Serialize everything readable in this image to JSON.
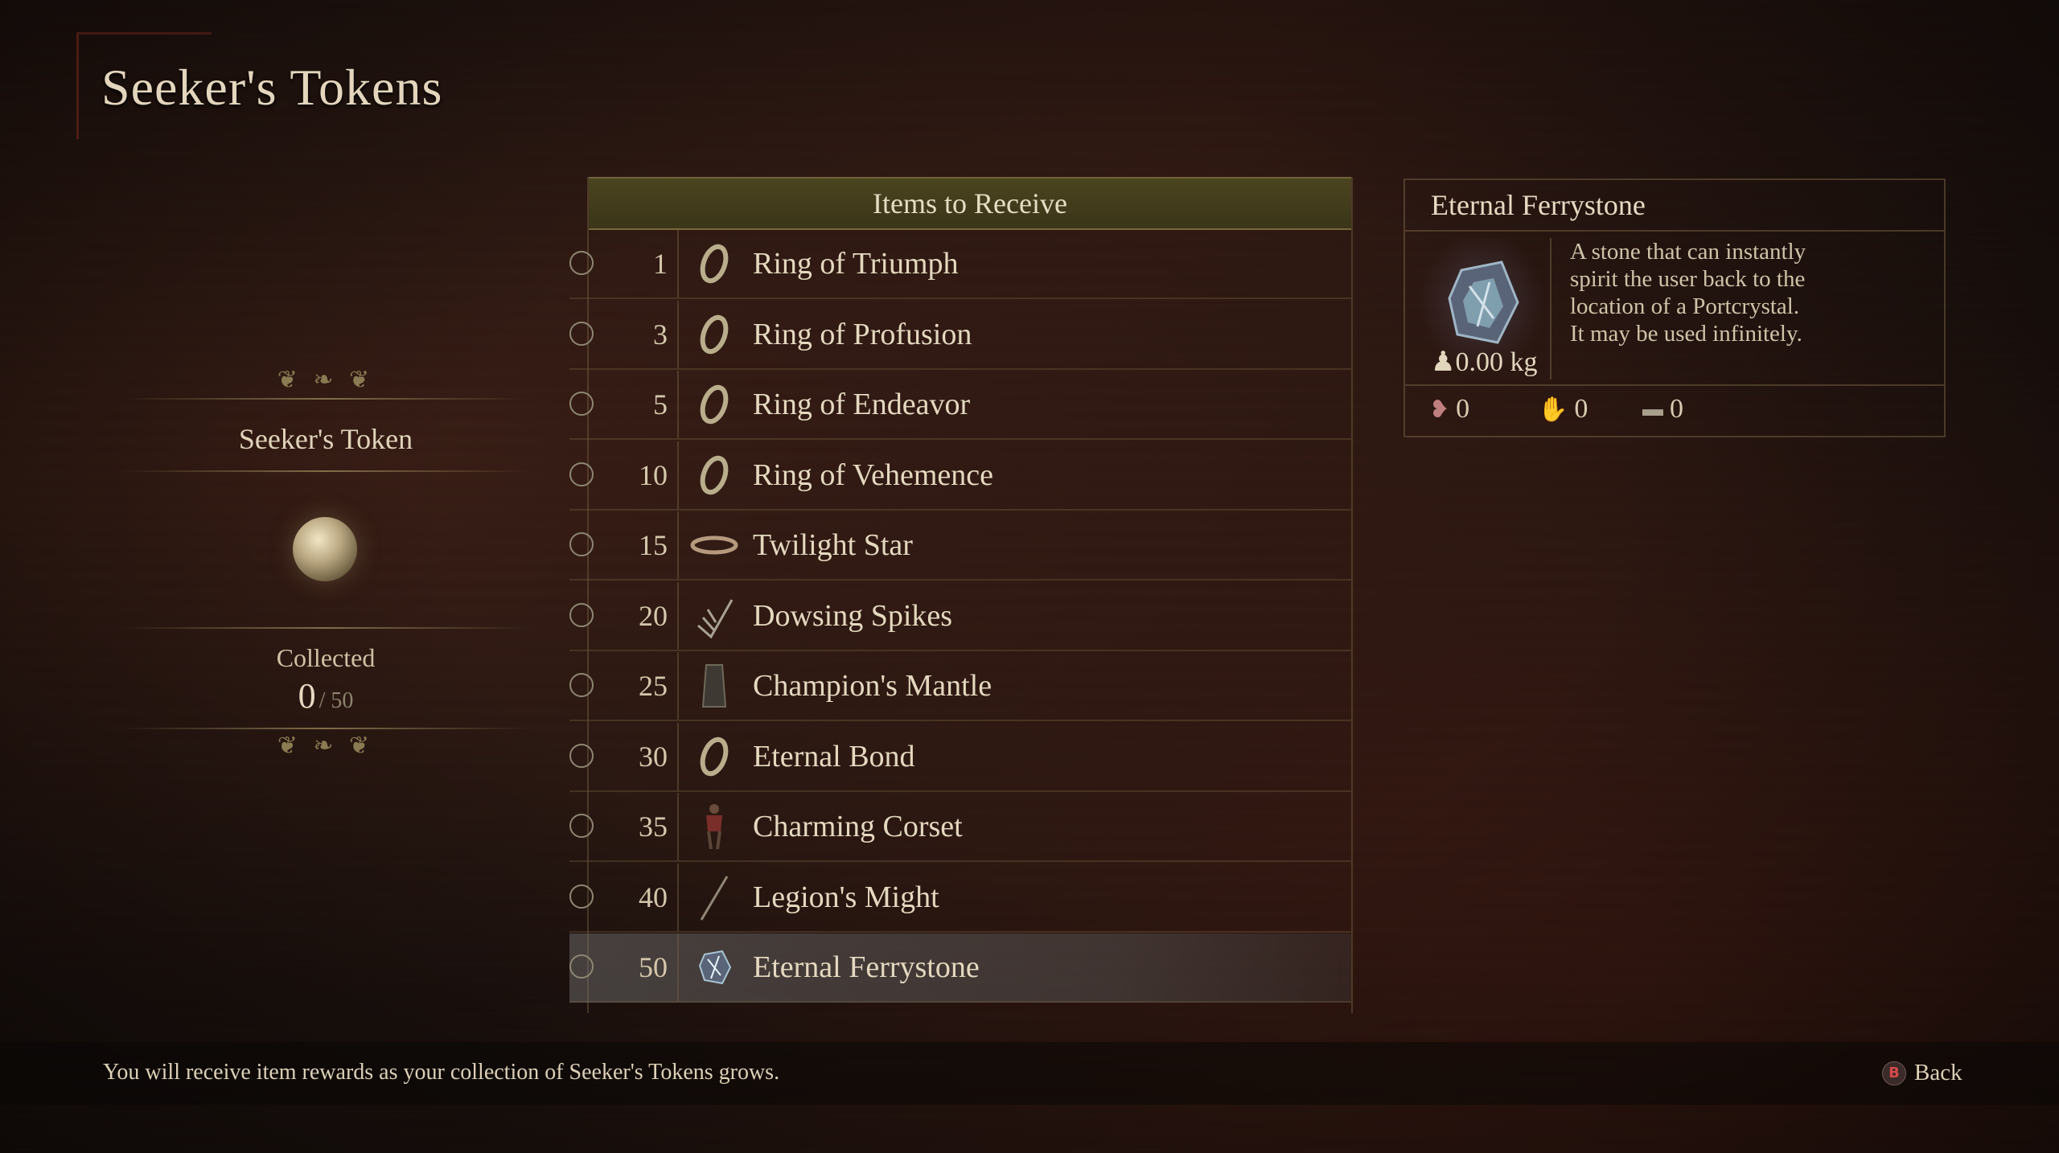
{
  "page": {
    "title": "Seeker's Tokens"
  },
  "token": {
    "name": "Seeker's Token",
    "collected_label": "Collected",
    "collected": "0",
    "total": "/ 50"
  },
  "list": {
    "header": "Items to Receive",
    "items": [
      {
        "threshold": "1",
        "name": "Ring of Triumph",
        "icon": "ring-icon"
      },
      {
        "threshold": "3",
        "name": "Ring of Profusion",
        "icon": "ring-icon"
      },
      {
        "threshold": "5",
        "name": "Ring of Endeavor",
        "icon": "ring-icon"
      },
      {
        "threshold": "10",
        "name": "Ring of Vehemence",
        "icon": "ring-icon"
      },
      {
        "threshold": "15",
        "name": "Twilight Star",
        "icon": "circlet-icon"
      },
      {
        "threshold": "20",
        "name": "Dowsing Spikes",
        "icon": "spikes-icon"
      },
      {
        "threshold": "25",
        "name": "Champion's Mantle",
        "icon": "mantle-icon"
      },
      {
        "threshold": "30",
        "name": "Eternal Bond",
        "icon": "ring-icon"
      },
      {
        "threshold": "35",
        "name": "Charming Corset",
        "icon": "armor-icon"
      },
      {
        "threshold": "40",
        "name": "Legion's Might",
        "icon": "staff-icon"
      },
      {
        "threshold": "50",
        "name": "Eternal Ferrystone",
        "icon": "ferrystone-icon",
        "selected": true
      }
    ]
  },
  "detail": {
    "title": "Eternal Ferrystone",
    "description": "A stone that can instantly\nspirit the user back to the\nlocation of a Portcrystal.\nIt may be used infinitely.",
    "weight": "0.00 kg",
    "stats": [
      {
        "icon": "owned-icon",
        "value": "0"
      },
      {
        "icon": "hand-icon",
        "value": "0"
      },
      {
        "icon": "storage-icon",
        "value": "0"
      }
    ]
  },
  "footer": {
    "hint": "You will receive item rewards as your collection of Seeker's Tokens grows.",
    "back_button_glyph": "B",
    "back_label": "Back"
  },
  "colors": {
    "selected_row": "#5f5f5f",
    "header_bar": "#4a4420",
    "text": "#d9cbb0",
    "button_b": "#d44a4a"
  }
}
